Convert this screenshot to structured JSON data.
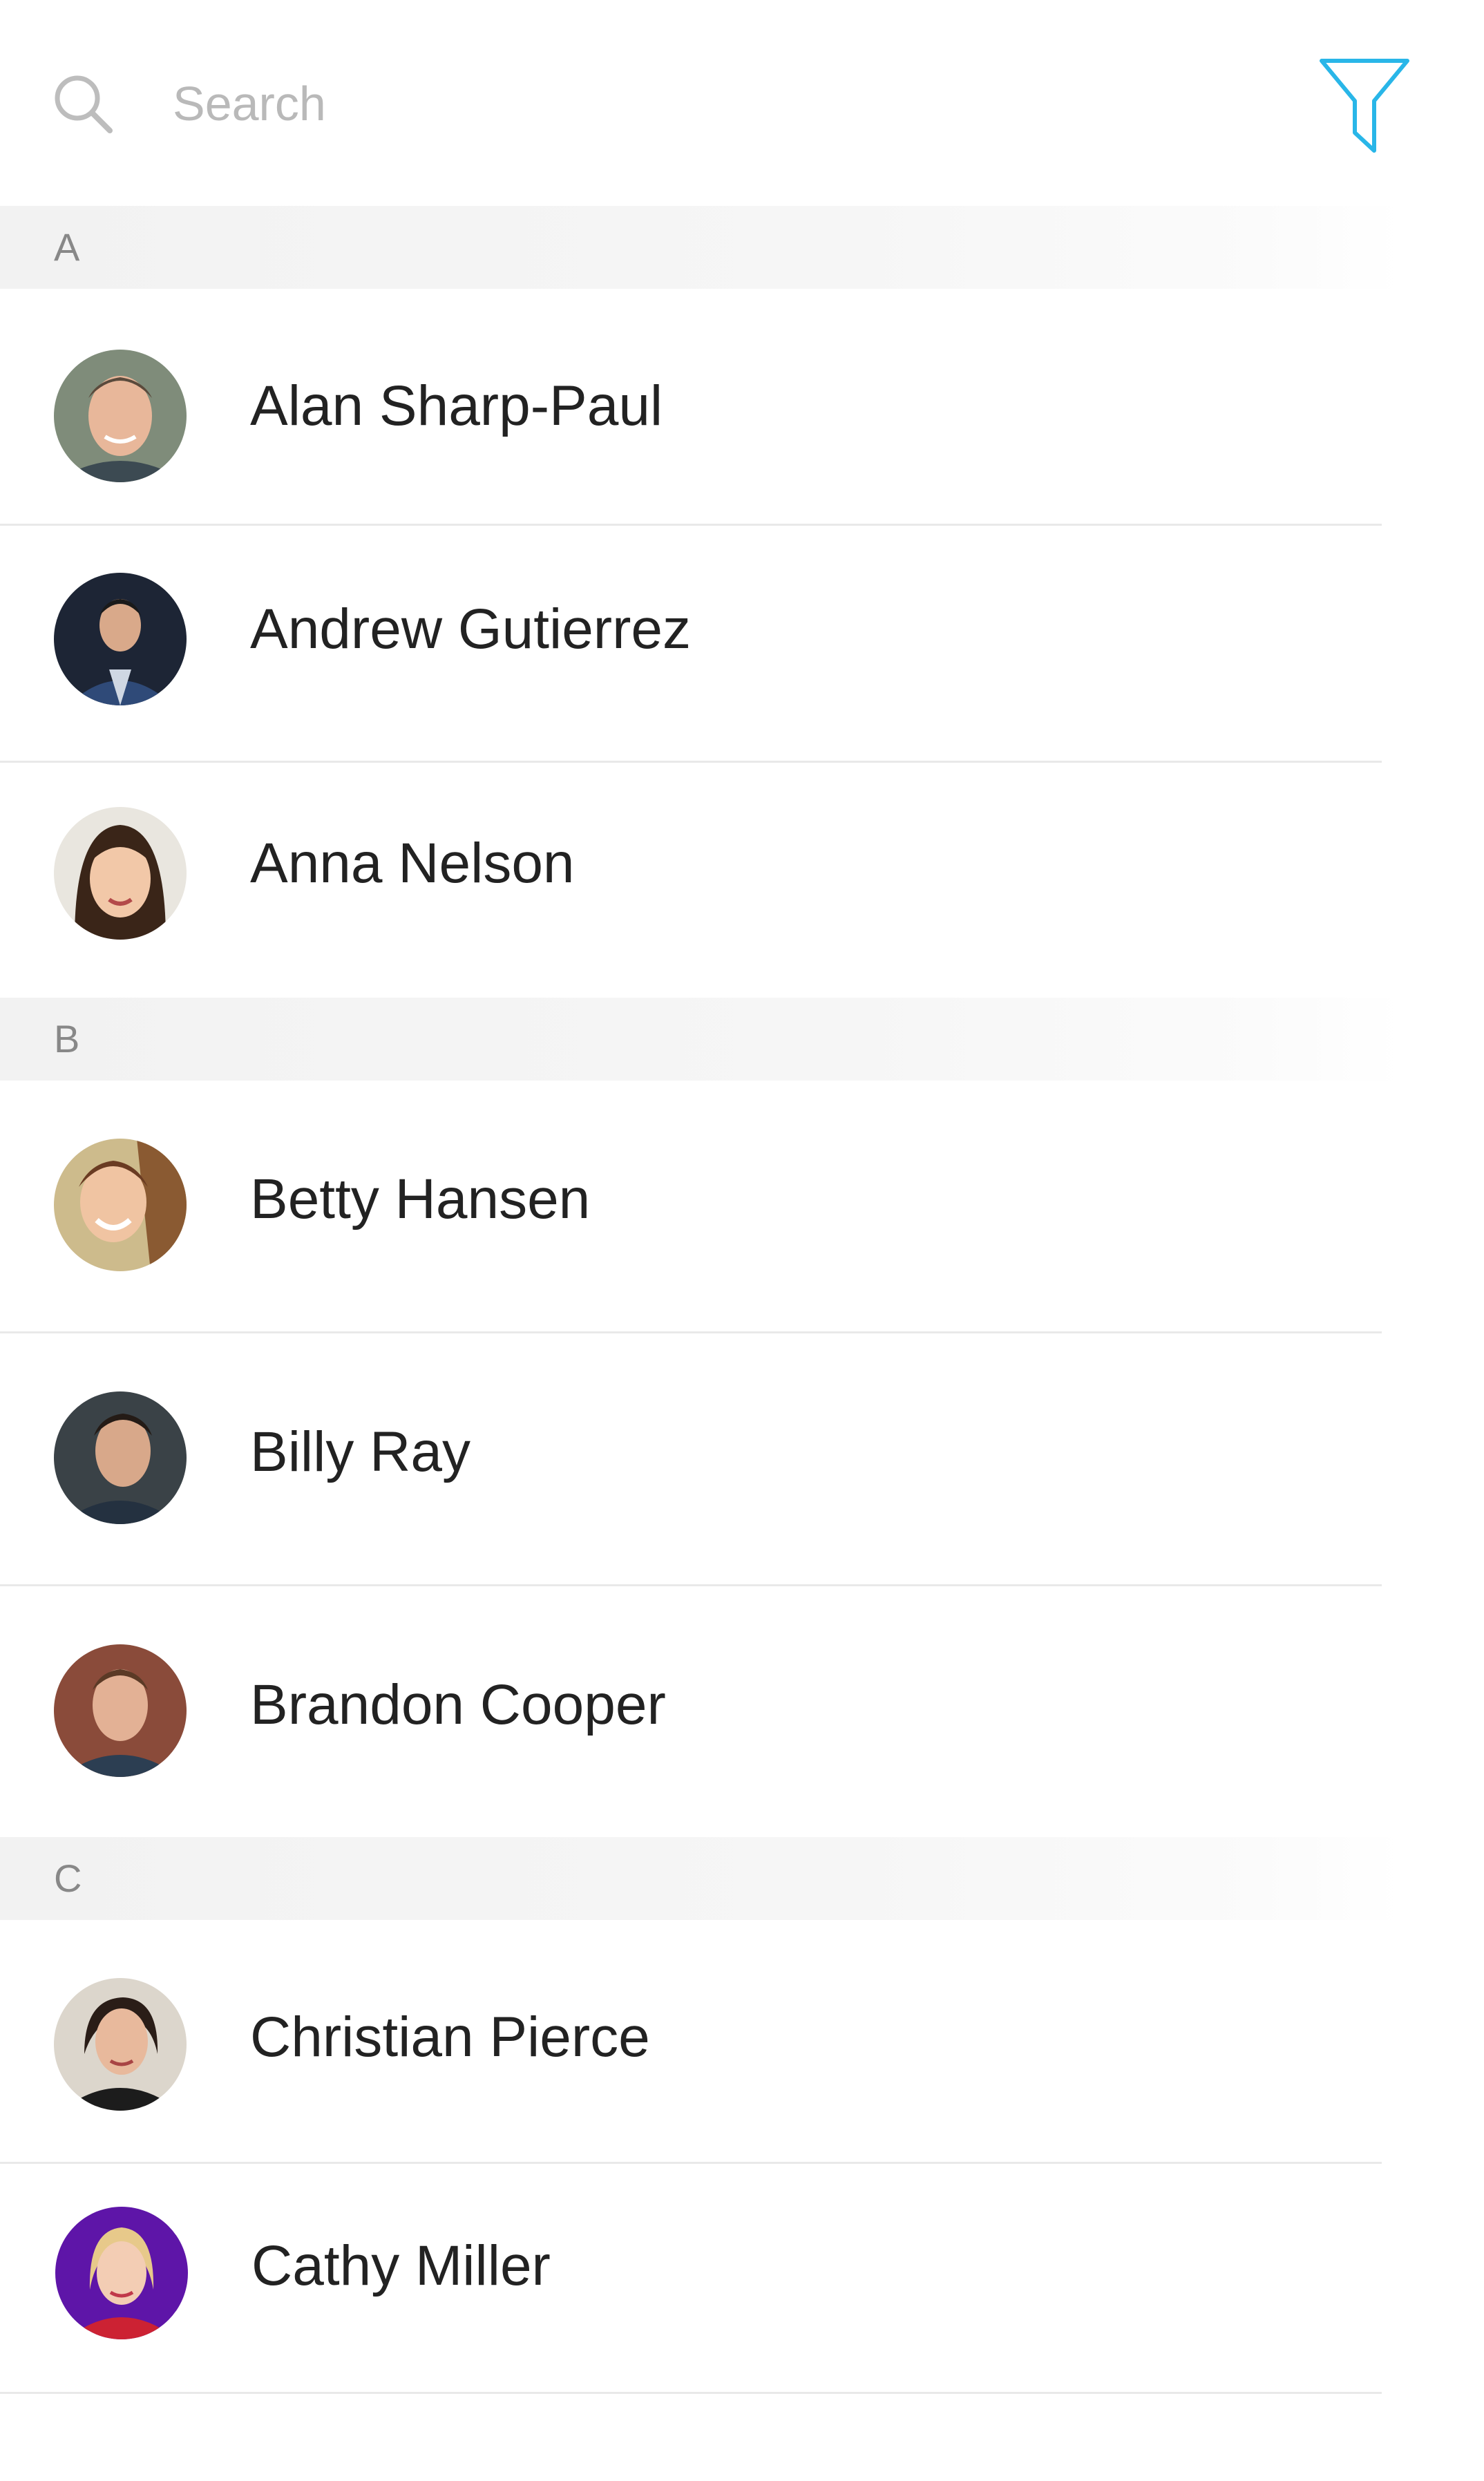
{
  "search": {
    "placeholder": "Search",
    "value": ""
  },
  "icons": {
    "search": "search-icon",
    "filter": "filter-icon"
  },
  "colors": {
    "accent": "#29b6e8",
    "section_header_bg": "#f4f4f4",
    "section_letter": "#888888",
    "divider": "#e9e9e9"
  },
  "sections": [
    {
      "letter": "A",
      "contacts": [
        {
          "name": "Alan Sharp-Paul"
        },
        {
          "name": "Andrew Gutierrez"
        },
        {
          "name": "Anna Nelson"
        }
      ]
    },
    {
      "letter": "B",
      "contacts": [
        {
          "name": "Betty Hansen"
        },
        {
          "name": "Billy Ray"
        },
        {
          "name": "Brandon Cooper"
        }
      ]
    },
    {
      "letter": "C",
      "contacts": [
        {
          "name": "Christian Pierce"
        },
        {
          "name": "Cathy Miller"
        }
      ]
    }
  ]
}
